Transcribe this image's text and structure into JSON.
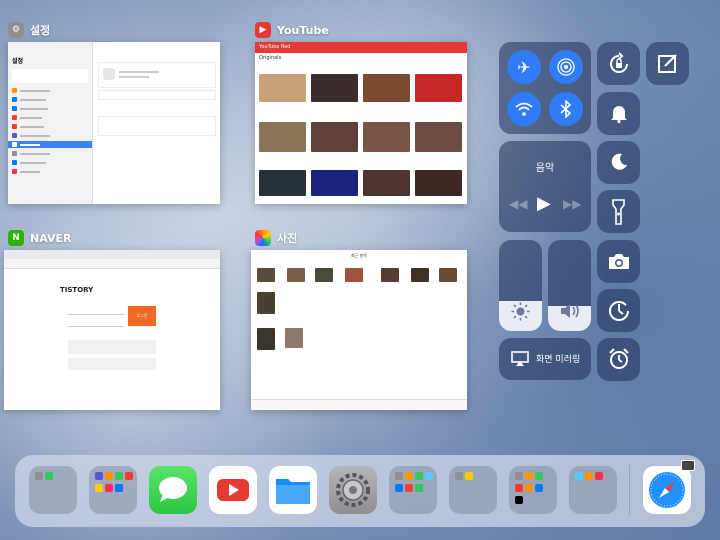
{
  "cards": {
    "settings": {
      "title": "설정",
      "sidebar_title": "설정",
      "colors": {
        "icon": "#8e8e93"
      }
    },
    "youtube": {
      "title": "YouTube",
      "brand": "YouTube Red",
      "section": "Originals",
      "colors": {
        "icon": "#e53935"
      }
    },
    "naver": {
      "title": "NAVER",
      "page_logo": "TISTORY",
      "login_button": "로그인",
      "colors": {
        "icon": "#2db400"
      }
    },
    "photos": {
      "title": "사진",
      "album_title": "최근 항목"
    }
  },
  "control_center": {
    "music_label": "음악",
    "screen_mirroring_label": "화면 미러링",
    "toggles": [
      "airplane-mode",
      "airdrop",
      "wifi",
      "bluetooth",
      "rotation-lock",
      "silent-mode",
      "do-not-disturb",
      "flashlight",
      "camera",
      "timer",
      "alarm",
      "notes"
    ],
    "brightness_level": 0.33,
    "volume_level": 0.28,
    "colors": {
      "active": "#2f7cf6"
    }
  },
  "dock": {
    "apps": [
      "folder",
      "folder",
      "messages",
      "youtube",
      "files",
      "settings",
      "folder",
      "folder",
      "folder",
      "folder",
      "safari"
    ]
  }
}
